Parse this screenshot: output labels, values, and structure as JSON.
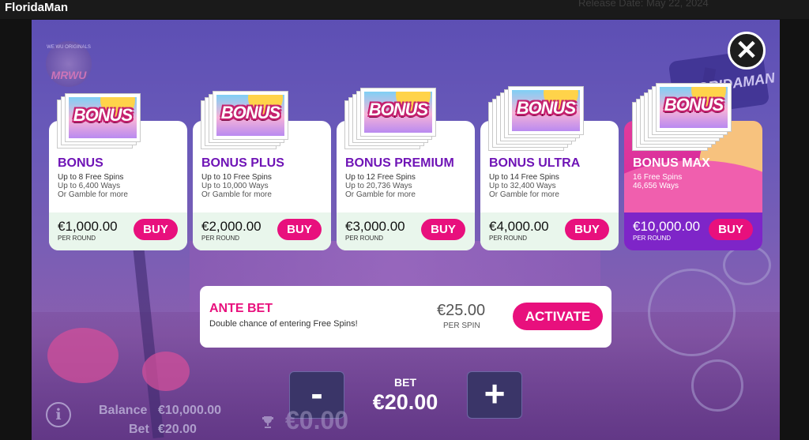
{
  "window": {
    "title": "FloridaMan",
    "faded_text": "Release Date: May 22, 2024"
  },
  "background": {
    "logo_top": "WE WU ORIGINALS",
    "logo_name": "MRWU",
    "sign_text": "FLORIDAMAN"
  },
  "close_label": "✕",
  "ticket_text": "BONUS",
  "cards": [
    {
      "name": "BONUS",
      "line1": "Up to 8 Free Spins",
      "line2": "Up to 6,400 Ways",
      "line3": "Or Gamble for more",
      "price": "€1,000.00",
      "per": "PER ROUND",
      "buy": "BUY"
    },
    {
      "name": "BONUS PLUS",
      "line1": "Up to 10 Free Spins",
      "line2": "Up to 10,000 Ways",
      "line3": "Or Gamble for more",
      "price": "€2,000.00",
      "per": "PER ROUND",
      "buy": "BUY"
    },
    {
      "name": "BONUS PREMIUM",
      "line1": "Up to 12 Free Spins",
      "line2": "Up to 20,736 Ways",
      "line3": "Or Gamble for more",
      "price": "€3,000.00",
      "per": "PER ROUND",
      "buy": "BUY"
    },
    {
      "name": "BONUS ULTRA",
      "line1": "Up to 14 Free Spins",
      "line2": "Up to 32,400 Ways",
      "line3": "Or Gamble for more",
      "price": "€4,000.00",
      "per": "PER ROUND",
      "buy": "BUY"
    },
    {
      "name": "BONUS MAX",
      "line1": "16 Free Spins",
      "line2": "46,656 Ways",
      "price": "€10,000.00",
      "per": "PER ROUND",
      "buy": "BUY"
    }
  ],
  "ante": {
    "title": "ANTE BET",
    "description": "Double chance of entering Free Spins!",
    "price": "€25.00",
    "per": "PER SPIN",
    "button": "ACTIVATE"
  },
  "bet": {
    "label": "BET",
    "value": "€20.00",
    "minus": "-",
    "plus": "+"
  },
  "footer": {
    "info": "i",
    "balance_label": "Balance",
    "balance_value": "€10,000.00",
    "bet_label": "Bet",
    "bet_value": "€20.00",
    "win_value": "€0.00"
  },
  "colors": {
    "accent_pink": "#e8107d",
    "title_purple": "#6f14b6",
    "card_footer": "#e9f6ec"
  }
}
